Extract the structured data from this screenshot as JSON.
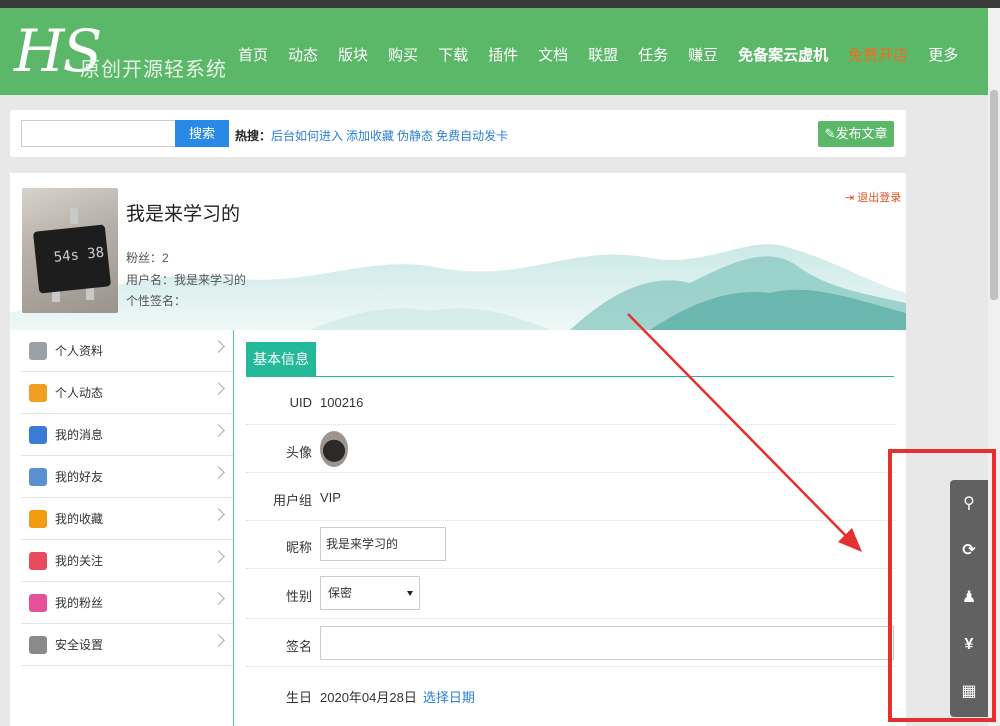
{
  "header": {
    "logo": "HS",
    "subtitle": "原创开源轻系统",
    "nav": [
      {
        "label": "首页",
        "style": "normal"
      },
      {
        "label": "动态",
        "style": "normal"
      },
      {
        "label": "版块",
        "style": "normal"
      },
      {
        "label": "购买",
        "style": "normal"
      },
      {
        "label": "下载",
        "style": "normal"
      },
      {
        "label": "插件",
        "style": "normal"
      },
      {
        "label": "文档",
        "style": "normal"
      },
      {
        "label": "联盟",
        "style": "normal"
      },
      {
        "label": "任务",
        "style": "normal"
      },
      {
        "label": "赚豆",
        "style": "normal"
      },
      {
        "label": "免备案云虚机",
        "style": "bold"
      },
      {
        "label": "免费开店",
        "style": "orange"
      },
      {
        "label": "更多",
        "style": "normal"
      }
    ]
  },
  "search": {
    "placeholder": "",
    "button": "搜索",
    "hot_label": "热搜：",
    "hot_links": [
      "后台如何进入",
      "添加收藏",
      "伪静态",
      "免费自动发卡"
    ],
    "publish": "发布文章"
  },
  "profile": {
    "avatar_chip_text": "54s 38",
    "username": "我是来学习的",
    "fans": "粉丝：2",
    "login_name": "用户名：我是来学习的",
    "signature": "个性签名：",
    "logout": "退出登录"
  },
  "sidebar": {
    "items": [
      {
        "label": "个人资料",
        "icon": "id-card-icon",
        "color": "#9aa0a6"
      },
      {
        "label": "个人动态",
        "icon": "star-icon",
        "color": "#f0a020"
      },
      {
        "label": "我的消息",
        "icon": "mailbox-icon",
        "color": "#3a7bd5"
      },
      {
        "label": "我的好友",
        "icon": "friends-icon",
        "color": "#5a8fd0"
      },
      {
        "label": "我的收藏",
        "icon": "box-icon",
        "color": "#f39c12"
      },
      {
        "label": "我的关注",
        "icon": "heart-icon",
        "color": "#e84a5f"
      },
      {
        "label": "我的粉丝",
        "icon": "fan-user-icon",
        "color": "#e6529a"
      },
      {
        "label": "安全设置",
        "icon": "gear-icon",
        "color": "#8a8a8a"
      }
    ]
  },
  "info": {
    "tab": "基本信息",
    "uid_label": "UID",
    "uid": "100216",
    "avatar_label": "头像",
    "group_label": "用户组",
    "group": "VIP",
    "nick_label": "昵称",
    "nick": "我是来学习的",
    "gender_label": "性别",
    "gender": "保密",
    "sign_label": "签名",
    "birthday_label": "生日",
    "birthday": "2020年04月28日",
    "choose_date": "选择日期"
  },
  "float_bar": [
    {
      "icon": "search-icon",
      "glyph": "⚲"
    },
    {
      "icon": "refresh-icon",
      "glyph": "⟳"
    },
    {
      "icon": "qq-icon",
      "glyph": "♟"
    },
    {
      "icon": "yen-icon",
      "glyph": "¥"
    },
    {
      "icon": "qrcode-icon",
      "glyph": "▦"
    }
  ],
  "colors": {
    "brand": "#5cb869",
    "teal": "#24b99a",
    "link": "#2b7fd6",
    "annotation": "#e53030"
  }
}
